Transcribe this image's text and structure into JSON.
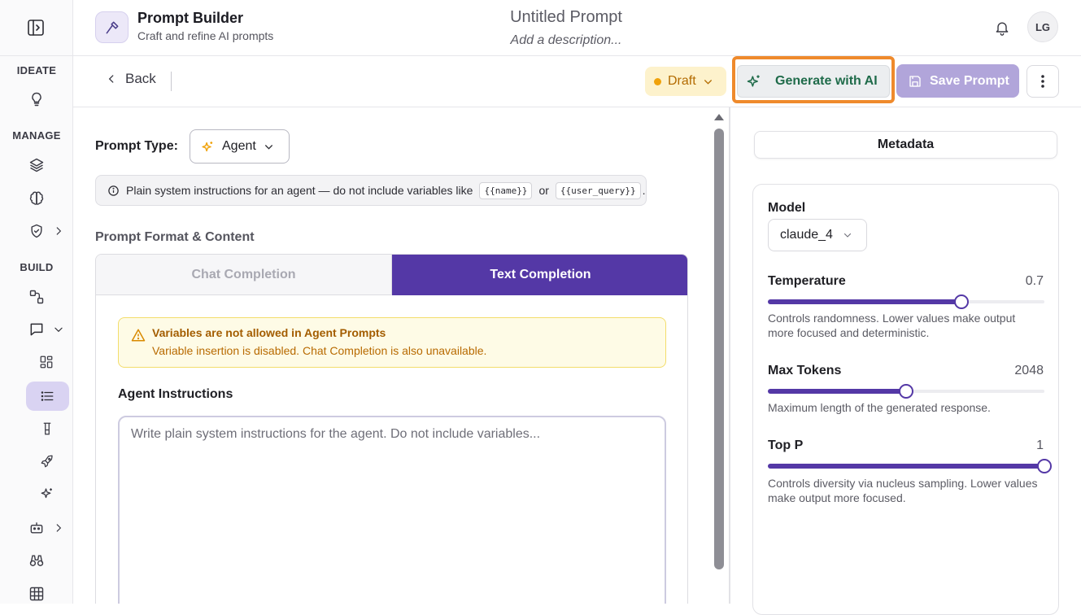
{
  "app": {
    "title": "Prompt Builder",
    "subtitle": "Craft and refine AI prompts",
    "user_initials": "LG"
  },
  "document": {
    "title": "Untitled Prompt",
    "description": "Add a description..."
  },
  "sidebar": {
    "sections": [
      {
        "label": "IDEATE",
        "items": [
          {
            "icon": "lightbulb-icon"
          }
        ]
      },
      {
        "label": "MANAGE",
        "items": [
          {
            "icon": "layers-icon"
          },
          {
            "icon": "brain-icon"
          },
          {
            "icon": "shield-icon",
            "expandable": true
          }
        ]
      },
      {
        "label": "BUILD",
        "items": [
          {
            "icon": "workflow-icon"
          },
          {
            "icon": "message-icon",
            "expanded": true
          },
          {
            "icon": "grid-icon"
          },
          {
            "icon": "list-icon",
            "active": true
          },
          {
            "icon": "flask-icon"
          },
          {
            "icon": "rocket-icon"
          },
          {
            "icon": "sparkle-icon"
          },
          {
            "icon": "bot-icon",
            "expandable": true
          },
          {
            "icon": "binoculars-icon"
          },
          {
            "icon": "table-icon"
          }
        ]
      }
    ]
  },
  "toolbar": {
    "back_label": "Back",
    "status_label": "Draft",
    "generate_label": "Generate with AI",
    "save_label": "Save Prompt"
  },
  "editor": {
    "prompt_type_label": "Prompt Type:",
    "prompt_type_value": "Agent",
    "info_text": "Plain system instructions for an agent — do not include variables like",
    "info_var_1": "{{name}}",
    "info_or": "or",
    "info_var_2": "{{user_query}}",
    "info_end": ".",
    "format_section_label": "Prompt Format & Content",
    "tabs": [
      {
        "label": "Chat Completion",
        "active": false,
        "disabled": true
      },
      {
        "label": "Text Completion",
        "active": true
      }
    ],
    "warning_title": "Variables are not allowed in Agent Prompts",
    "warning_text": "Variable insertion is disabled. Chat Completion is also unavailable.",
    "agent_label": "Agent Instructions",
    "agent_placeholder": "Write plain system instructions for the agent. Do not include variables..."
  },
  "settings": {
    "tab_label": "Metadata",
    "model_label": "Model",
    "model_value": "claude_4",
    "temperature": {
      "label": "Temperature",
      "value": "0.7",
      "fraction": 0.7,
      "description": "Controls randomness. Lower values make output more focused and deterministic."
    },
    "max_tokens": {
      "label": "Max Tokens",
      "value": "2048",
      "fraction": 0.5,
      "description": "Maximum length of the generated response."
    },
    "top_p": {
      "label": "Top P",
      "value": "1",
      "fraction": 1.0,
      "description": "Controls diversity via nucleus sampling. Lower values make output more focused."
    }
  },
  "colors": {
    "accent": "#5438a6",
    "save_disabled": "#b1a5da",
    "draft_bg": "#fdf2cc",
    "highlight": "#ef8a2c",
    "generate_text": "#1f6b4a"
  }
}
